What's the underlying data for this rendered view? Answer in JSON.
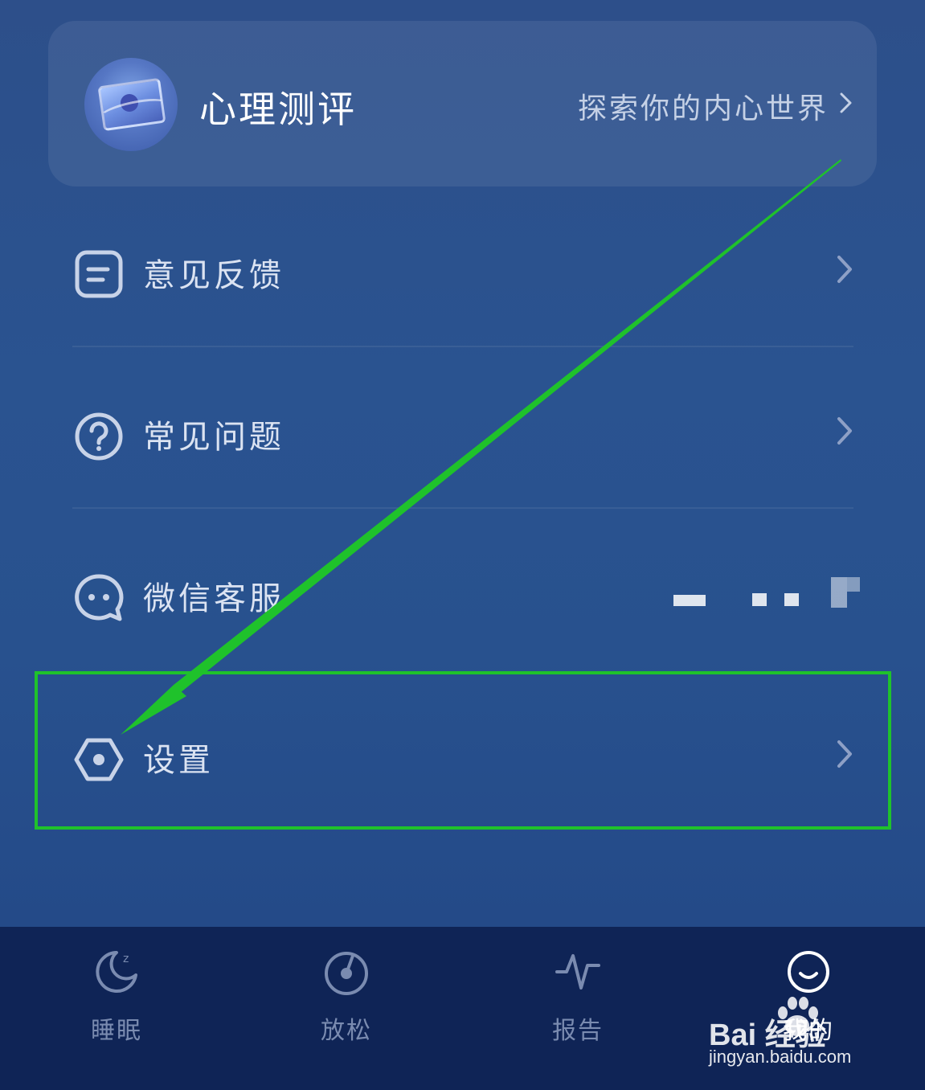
{
  "card": {
    "title": "心理测评",
    "subtitle": "探索你的内心世界",
    "icon": "psychology-test-avatar"
  },
  "menu": [
    {
      "label": "意见反馈",
      "icon": "feedback-icon",
      "has_chevron": true
    },
    {
      "label": "常见问题",
      "icon": "question-icon",
      "has_chevron": true
    },
    {
      "label": "微信客服",
      "icon": "wechat-service-icon",
      "has_chevron": false
    },
    {
      "label": "设置",
      "icon": "settings-icon",
      "has_chevron": true
    }
  ],
  "tabs": [
    {
      "label": "睡眠",
      "icon": "moon-sleep-icon",
      "active": false
    },
    {
      "label": "放松",
      "icon": "relax-dial-icon",
      "active": false
    },
    {
      "label": "报告",
      "icon": "pulse-report-icon",
      "active": false
    },
    {
      "label": "我的",
      "icon": "smile-profile-icon",
      "active": true
    }
  ],
  "watermark": {
    "brand": "Bai  经验",
    "site": "jingyan.baidu.com"
  },
  "colors": {
    "highlight": "#1fc22b",
    "tabbar_bg": "#0f2456",
    "tab_inactive": "#7a8bb0",
    "tab_active": "#ffffff"
  }
}
